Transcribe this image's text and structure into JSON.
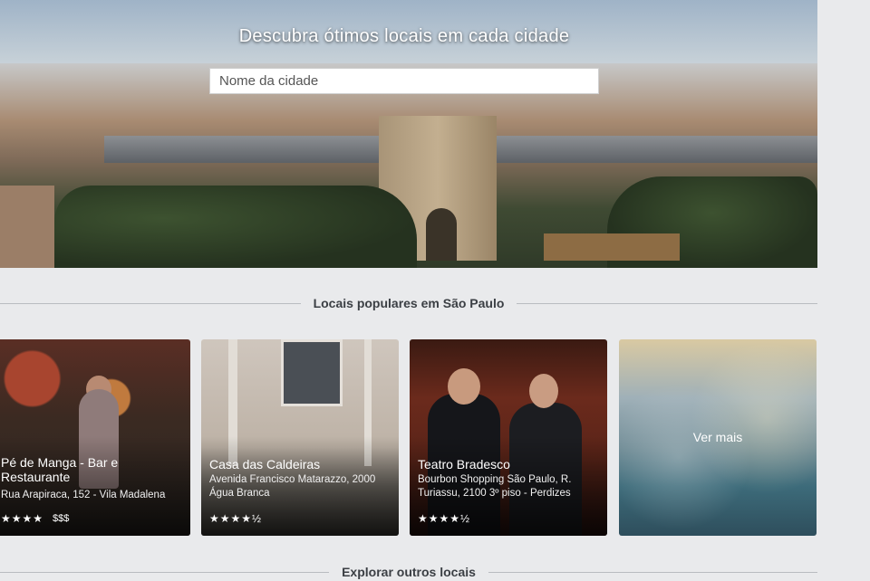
{
  "hero": {
    "title": "Descubra ótimos locais em cada cidade",
    "search_placeholder": "Nome da cidade"
  },
  "popular": {
    "heading": "Locais populares em São Paulo",
    "cards": [
      {
        "name": "Pé de Manga - Bar e Restaurante",
        "address": "Rua Arapiraca, 152 - Vila Madalena",
        "stars": "★★★★",
        "price": "$$$"
      },
      {
        "name": "Casa das Caldeiras",
        "address": "Avenida Francisco Matarazzo, 2000 Água Branca",
        "stars": "★★★★½"
      },
      {
        "name": "Teatro Bradesco",
        "address": "Bourbon Shopping São Paulo, R. Turiassu, 2100 3º piso - Perdizes",
        "stars": "★★★★½"
      }
    ],
    "see_more": "Ver mais"
  },
  "explore": {
    "heading": "Explorar outros locais"
  }
}
